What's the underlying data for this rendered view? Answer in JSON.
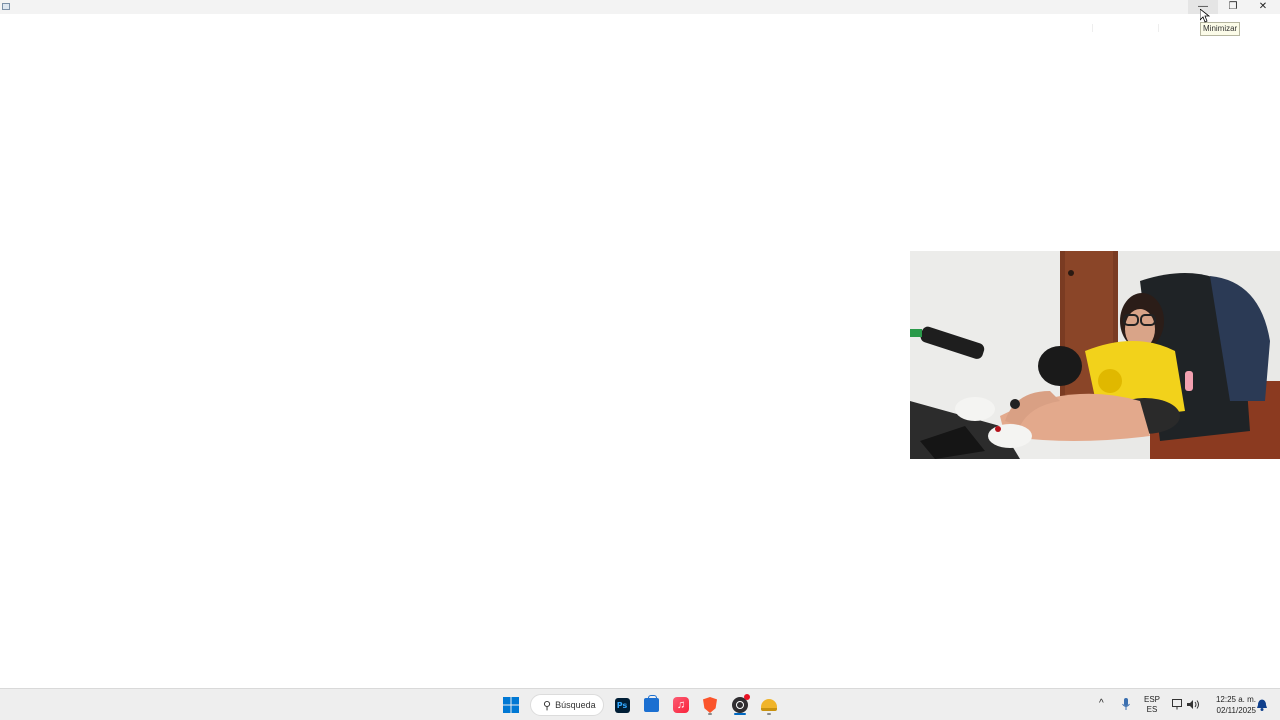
{
  "window": {
    "titlebar": {
      "minimize_glyph": "—",
      "restore_glyph": "❐",
      "close_glyph": "✕",
      "tooltip": "Minimizar"
    }
  },
  "video_overlay": {
    "description_icon": "video-feed"
  },
  "taskbar": {
    "search_label": "Búsqueda",
    "pinned_apps": [
      {
        "name": "start",
        "icon": "windows-icon"
      },
      {
        "name": "photoshop",
        "icon": "photoshop-icon",
        "label": "Ps"
      },
      {
        "name": "microsoft-store",
        "icon": "store-icon"
      },
      {
        "name": "apple-music",
        "icon": "music-icon",
        "label": "♫"
      },
      {
        "name": "brave",
        "icon": "brave-icon"
      },
      {
        "name": "obs",
        "icon": "obs-icon"
      },
      {
        "name": "app",
        "icon": "hat-icon"
      }
    ],
    "tray": {
      "chevron": "^",
      "language_top": "ESP",
      "language_bottom": "ES",
      "time": "12:25 a. m.",
      "date": "02/11/2025"
    },
    "colors": {
      "accent": "#0078d4",
      "running": "#0067c0",
      "obs_badge": "#e81123"
    }
  }
}
